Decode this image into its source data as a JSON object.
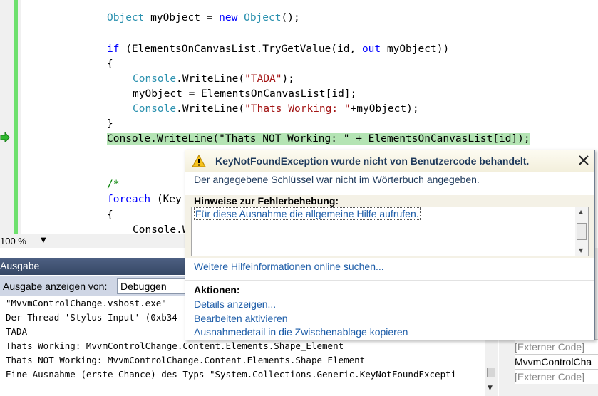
{
  "editor": {
    "lines": [
      {
        "parts": [
          [
            "tp",
            "Object"
          ],
          [
            "",
            "  myObject = "
          ],
          [
            "kw",
            "new"
          ],
          [
            "",
            ""
          ]
        ]
      },
      {
        "parts": []
      }
    ],
    "l1a": "Object",
    "l1b": " myObject = ",
    "l1c": "new",
    "l1d": " ",
    "l1e": "Object",
    "l1f": "();",
    "l2a": "if",
    "l2b": " (ElementsOnCanvasList.TryGetValue(id, ",
    "l2c": "out",
    "l2d": " myObject))",
    "l3": "{",
    "l4a": "Console",
    "l4b": ".WriteLine(",
    "l4c": "\"TADA\"",
    "l4d": ");",
    "l5": "myObject = ElementsOnCanvasList[id];",
    "l6a": "Console",
    "l6b": ".WriteLine(",
    "l6c": "\"Thats Working: \"",
    "l6d": "+myObject);",
    "l7": "}",
    "l8": "Console.WriteLine(\"Thats NOT Working: \" + ElementsOnCanvasList[id]);",
    "l9": "/*",
    "l10a": "foreach",
    "l10b": " (Key",
    "l11": "{",
    "l12": "Console.W"
  },
  "zoom": {
    "value": "100 %"
  },
  "output": {
    "title": "Ausgabe",
    "show_from_label": "Ausgabe anzeigen von:",
    "source_value": "Debuggen",
    "lines": [
      "\"MvvmControlChange.vshost.exe\"",
      "Der Thread 'Stylus Input' (0xb34",
      "TADA",
      "Thats Working: MvvmControlChange.Content.Elements.Shape_Element",
      "Thats NOT Working: MvvmControlChange.Content.Elements.Shape_Element",
      "Eine Ausnahme (erste Chance) des Typs \"System.Collections.Generic.KeyNotFoundExcepti"
    ]
  },
  "callstack": {
    "rows": [
      "[Externer Code]",
      "MvvmControlCha",
      "[Externer Code]"
    ]
  },
  "exception": {
    "title": "KeyNotFoundException wurde nicht von Benutzercode behandelt.",
    "message": "Der angegebene Schlüssel war nicht im Wörterbuch angegeben.",
    "tips_heading": "Hinweise zur Fehlerbehebung:",
    "tip_link": "Für diese Ausnahme die allgemeine Hilfe aufrufen.",
    "more_help": "Weitere Hilfeinformationen online suchen...",
    "actions_heading": "Aktionen:",
    "actions": [
      "Details anzeigen...",
      "Bearbeiten aktivieren",
      "Ausnahmedetail in die Zwischenablage kopieren"
    ]
  },
  "colors": {
    "keyword": "#0000ff",
    "type": "#2b91af",
    "string": "#a31515",
    "link": "#1c5ca8",
    "statement_highlight": "#b4e4b4"
  },
  "icons": [
    "execution-arrow-icon",
    "warning-icon",
    "close-icon",
    "dropdown-arrow-icon"
  ]
}
